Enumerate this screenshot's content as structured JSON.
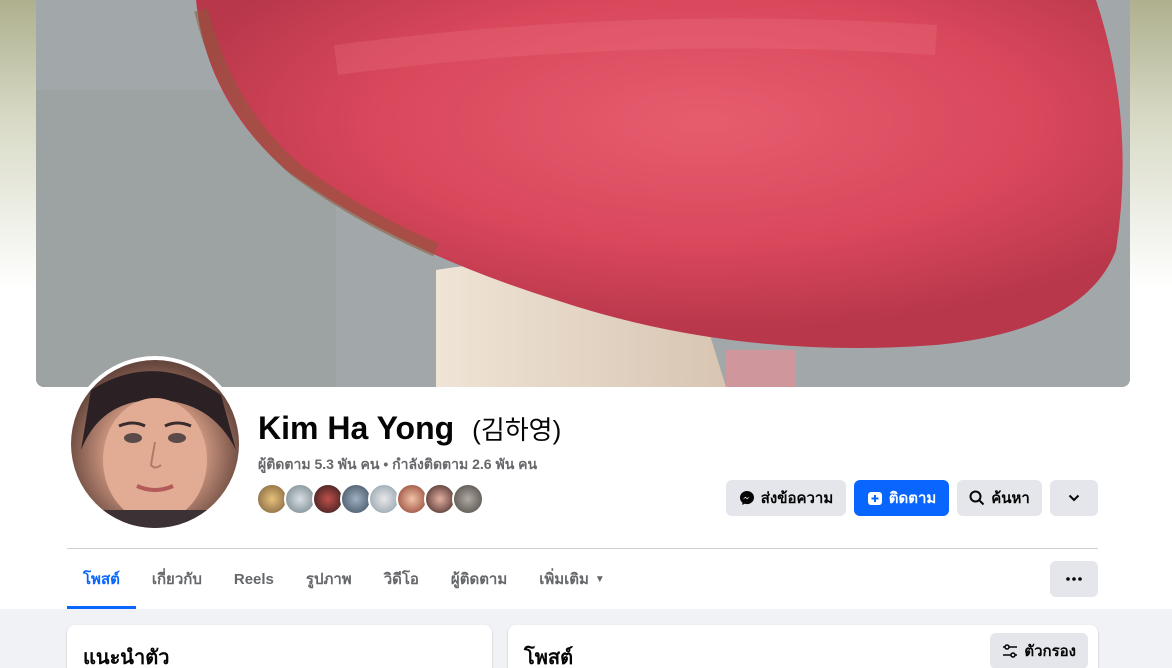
{
  "profile": {
    "name": "Kim Ha Yong",
    "alt_name": "(김하영)",
    "stats": "ผู้ติดตาม 5.3 พัน คน • กำลังติดตาม 2.6 พัน คน"
  },
  "actions": {
    "message_label": "ส่งข้อความ",
    "follow_label": "ติดตาม",
    "search_label": "ค้นหา"
  },
  "tabs": [
    {
      "label": "โพสต์"
    },
    {
      "label": "เกี่ยวกับ"
    },
    {
      "label": "Reels"
    },
    {
      "label": "รูปภาพ"
    },
    {
      "label": "วิดีโอ"
    },
    {
      "label": "ผู้ติดตาม"
    },
    {
      "label": "เพิ่มเติม"
    }
  ],
  "intro_card": {
    "title": "แนะนำตัว"
  },
  "posts_card": {
    "title": "โพสต์",
    "filter_label": "ตัวกรอง"
  },
  "colors": {
    "accent": "#0866ff",
    "button_gray": "#e4e6eb",
    "secondary_text": "#65676b"
  },
  "icons": [
    "messenger-icon",
    "follow-plus-icon",
    "search-icon",
    "chevron-down-icon",
    "more-dots-icon",
    "filter-sliders-icon"
  ]
}
